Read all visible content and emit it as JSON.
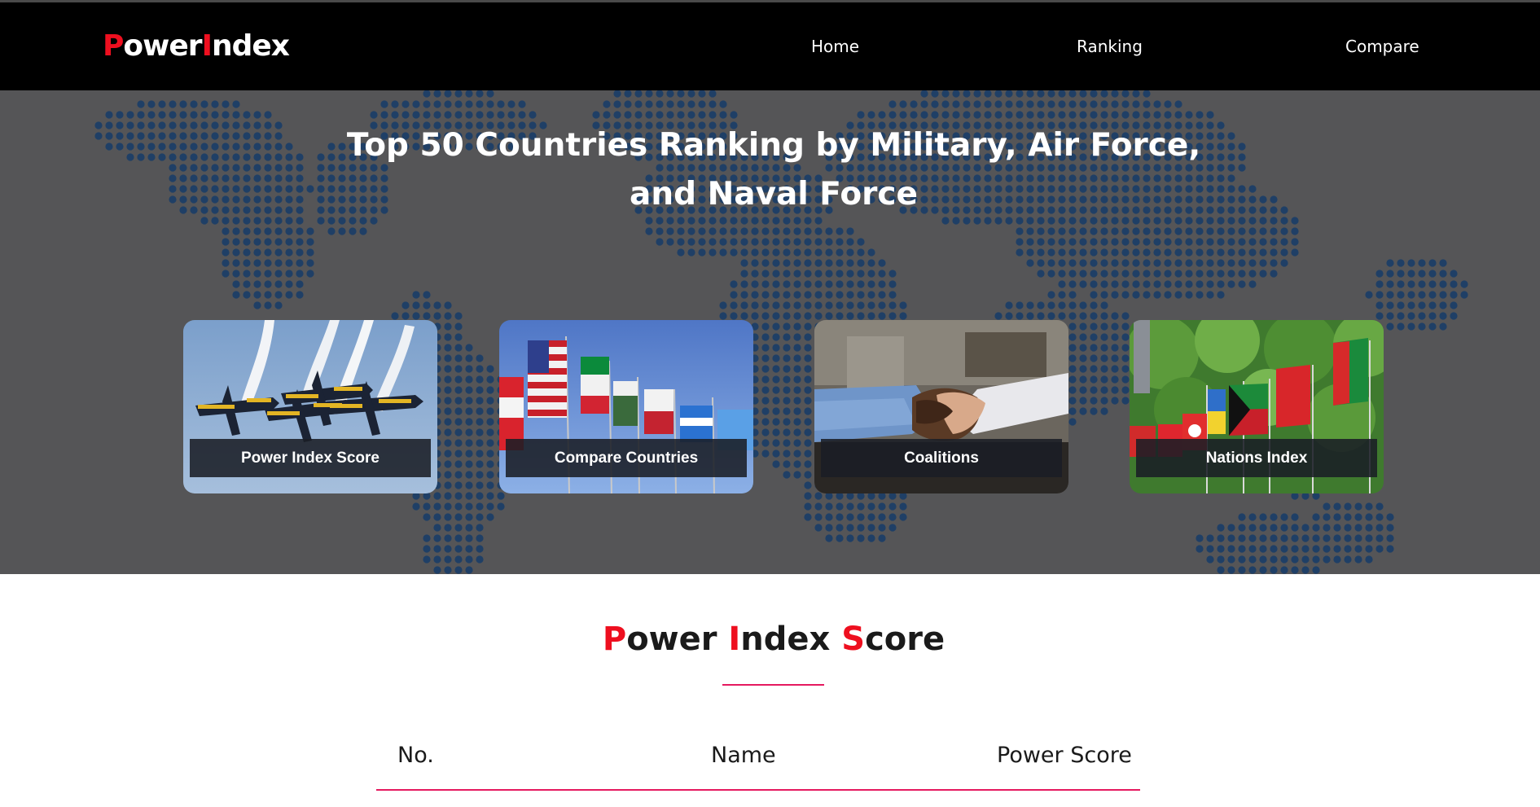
{
  "brand": {
    "logo_p": "P",
    "logo_ower": "ower",
    "logo_i": "I",
    "logo_ndex": "ndex"
  },
  "nav": {
    "home": "Home",
    "ranking": "Ranking",
    "compare": "Compare"
  },
  "hero": {
    "title": "Top 50 Countries Ranking by Military, Air Force, and Naval Force",
    "cards": [
      {
        "label": "Power Index Score",
        "image": "jets-photo"
      },
      {
        "label": "Compare Countries",
        "image": "flags-photo"
      },
      {
        "label": "Coalitions",
        "image": "handshake-photo"
      },
      {
        "label": "Nations Index",
        "image": "nation-flags-photo"
      }
    ]
  },
  "score_section": {
    "title_p": "P",
    "title_ower": "ower ",
    "title_i": "I",
    "title_ndex": "ndex ",
    "title_s": "S",
    "title_core": "core",
    "columns": [
      "No.",
      "Name",
      "Power Score"
    ]
  },
  "colors": {
    "accent_red": "#ee0f1f",
    "underline_pink": "#e5195f",
    "navbar_bg": "#000000",
    "hero_bg": "#555557",
    "map_dot": "#1f3f66"
  }
}
